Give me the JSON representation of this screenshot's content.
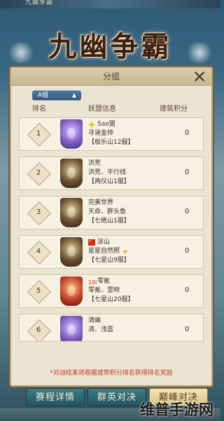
{
  "header": {
    "tab": "九幽争霸",
    "banner_title": "九幽争霸"
  },
  "panel": {
    "title": "分组",
    "group_tab": "A组",
    "columns": [
      "排名",
      "妖盟信息",
      "建筑积分"
    ],
    "rows": [
      {
        "rank": "1",
        "guild": "Sao盟",
        "leaders": "寻道金帅",
        "server": "【极乐山12服】",
        "score": "0",
        "emblem": "purple",
        "flag_icon": "flower-icon"
      },
      {
        "rank": "2",
        "guild": "洪荒",
        "leaders": "洪荒、平行线",
        "server": "【两仪山1服】",
        "score": "0",
        "emblem": "gold",
        "flag_icon": ""
      },
      {
        "rank": "3",
        "guild": "完美世界",
        "leaders": "天命、胖头鱼",
        "server": "【七绝山1服】",
        "score": "0",
        "emblem": "gold",
        "flag_icon": ""
      },
      {
        "rank": "4",
        "guild": "涂山",
        "leaders": "星星自然照",
        "server": "【七星山9服】",
        "score": "0",
        "emblem": "gold",
        "flag_icon": "china-flag-icon"
      },
      {
        "rank": "5",
        "guild": "零氪",
        "leaders": "零氪、霊時",
        "server": "【七星山20服】",
        "score": "0",
        "emblem": "red",
        "flag_icon": "100-emoji-icon"
      },
      {
        "rank": "6",
        "guild": "清幽",
        "leaders": "清、浅蓝",
        "server": "",
        "score": "0",
        "emblem": "purple",
        "flag_icon": ""
      }
    ],
    "footnote": "*对战结束将根据建筑积分排名获得排名奖励"
  },
  "buttons": {
    "schedule": "赛程详情",
    "heroes": "群英对决",
    "peak": "巅峰对决"
  },
  "watermark": "维普手游网"
}
